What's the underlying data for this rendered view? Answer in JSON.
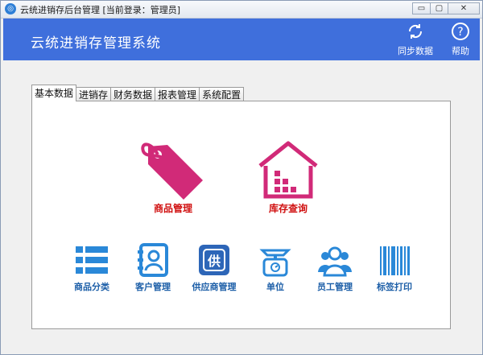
{
  "window": {
    "title": "云统进销存后台管理 [当前登录：管理员]",
    "icon": "app-logo-icon",
    "controls": {
      "minimize": "▭",
      "maximize": "▢",
      "close": "✕"
    }
  },
  "header": {
    "title": "云统进销存管理系统",
    "sync_label": "同步数据",
    "help_label": "帮助"
  },
  "tabs": [
    {
      "label": "基本数据",
      "active": true
    },
    {
      "label": "进销存",
      "active": false
    },
    {
      "label": "财务数据",
      "active": false
    },
    {
      "label": "报表管理",
      "active": false
    },
    {
      "label": "系统配置",
      "active": false
    }
  ],
  "main_tiles": [
    {
      "label": "商品管理",
      "icon": "price-tag-icon"
    },
    {
      "label": "库存查询",
      "icon": "warehouse-icon"
    }
  ],
  "small_tiles": [
    {
      "label": "商品分类",
      "icon": "list-icon"
    },
    {
      "label": "客户管理",
      "icon": "contact-book-icon"
    },
    {
      "label": "供应商管理",
      "icon": "supplier-icon",
      "glyph": "供"
    },
    {
      "label": "单位",
      "icon": "scale-icon"
    },
    {
      "label": "员工管理",
      "icon": "staff-group-icon"
    },
    {
      "label": "标签打印",
      "icon": "barcode-icon"
    }
  ],
  "colors": {
    "header": "#3f6fdc",
    "main_icon": "#d12a78",
    "main_label": "#d01010",
    "small_icon": "#2a88d8",
    "small_label": "#1d5fa8"
  }
}
